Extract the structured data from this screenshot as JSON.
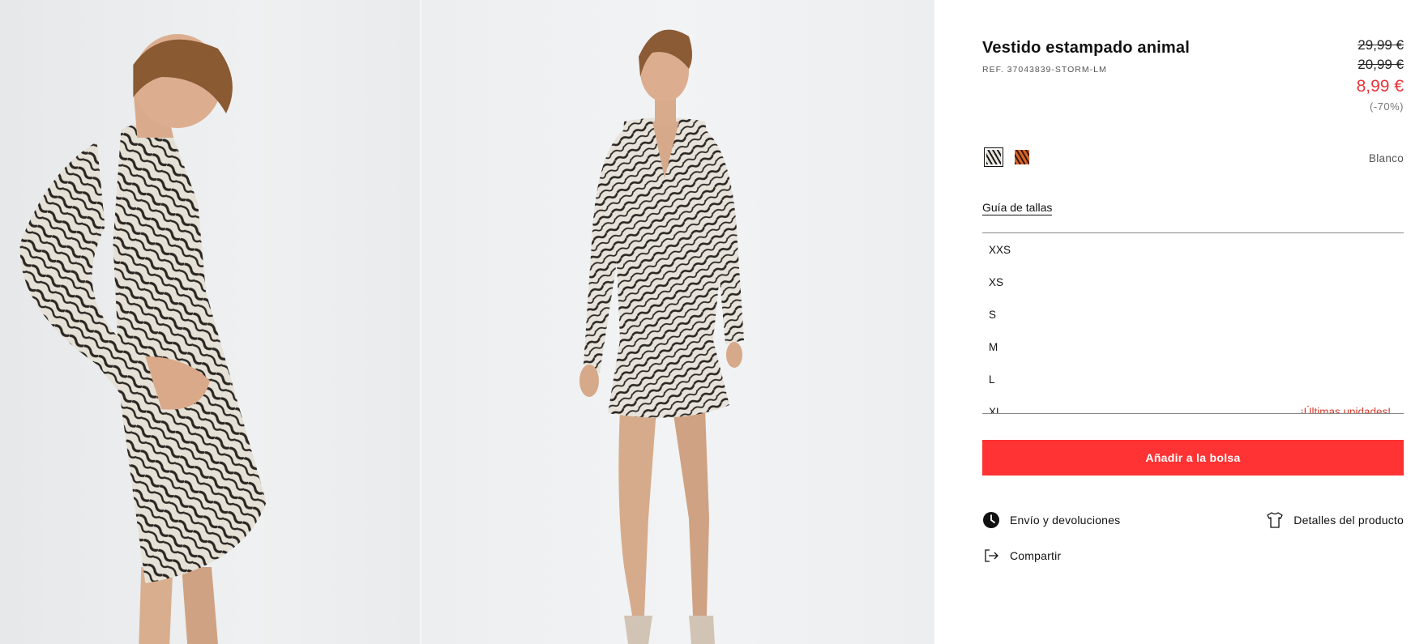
{
  "gallery": {
    "images": [
      "dress side view photo",
      "dress front view photo"
    ]
  },
  "product": {
    "title": "Vestido estampado animal",
    "ref": "REF. 37043839-STORM-LM",
    "price_original": "29,99 €",
    "price_previous": "20,99 €",
    "price_current": "8,99 €",
    "discount": "(-70%)"
  },
  "colors": {
    "selected_name": "Blanco",
    "swatches": [
      {
        "name": "zebra-swatch",
        "selected": true
      },
      {
        "name": "tiger-swatch",
        "selected": false
      }
    ]
  },
  "size_guide_label": "Guía de tallas",
  "sizes": [
    {
      "label": "XXS",
      "note": ""
    },
    {
      "label": "XS",
      "note": ""
    },
    {
      "label": "S",
      "note": ""
    },
    {
      "label": "M",
      "note": ""
    },
    {
      "label": "L",
      "note": ""
    },
    {
      "label": "XL",
      "note": "¡Últimas unidades!"
    }
  ],
  "add_to_bag_label": "Añadir a la bolsa",
  "links": {
    "shipping": "Envío y devoluciones",
    "details": "Detalles del producto",
    "share": "Compartir"
  },
  "colors_palette": {
    "accent_red": "#ff3333",
    "sale_price_red": "#e8343a",
    "low_stock_red": "#d33b2c"
  }
}
